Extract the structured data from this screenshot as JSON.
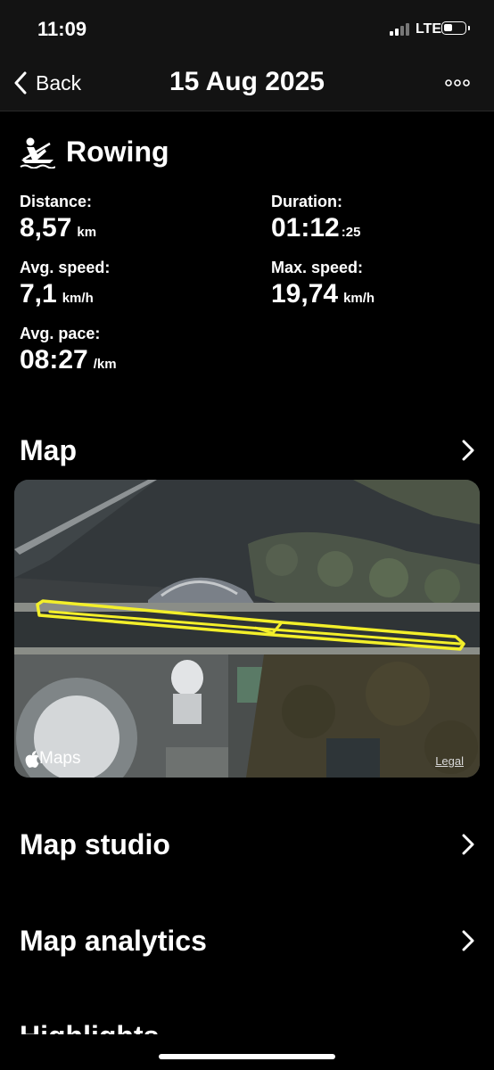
{
  "status_bar": {
    "time": "11:09",
    "network": "LTE"
  },
  "nav": {
    "back_label": "Back",
    "title": "15 Aug 2025",
    "back_icon": "chevron-left-icon",
    "more_icon": "ellipsis-icon"
  },
  "activity": {
    "icon": "rowing-icon",
    "title": "Rowing"
  },
  "stats": {
    "distance": {
      "label": "Distance:",
      "value": "8,57",
      "unit": "km"
    },
    "duration": {
      "label": "Duration:",
      "value": "01:12",
      "unit": ":25"
    },
    "avg_speed": {
      "label": "Avg. speed:",
      "value": "7,1",
      "unit": "km/h"
    },
    "max_speed": {
      "label": "Max. speed:",
      "value": "19,74",
      "unit": "km/h"
    },
    "avg_pace": {
      "label": "Avg. pace:",
      "value": "08:27",
      "unit": "/km"
    }
  },
  "sections": {
    "map": "Map",
    "map_studio": "Map studio",
    "map_analytics": "Map analytics",
    "next_partial": "Highlights"
  },
  "map": {
    "attribution": "Maps",
    "legal": "Legal",
    "track_color": "#f3ef2a"
  }
}
